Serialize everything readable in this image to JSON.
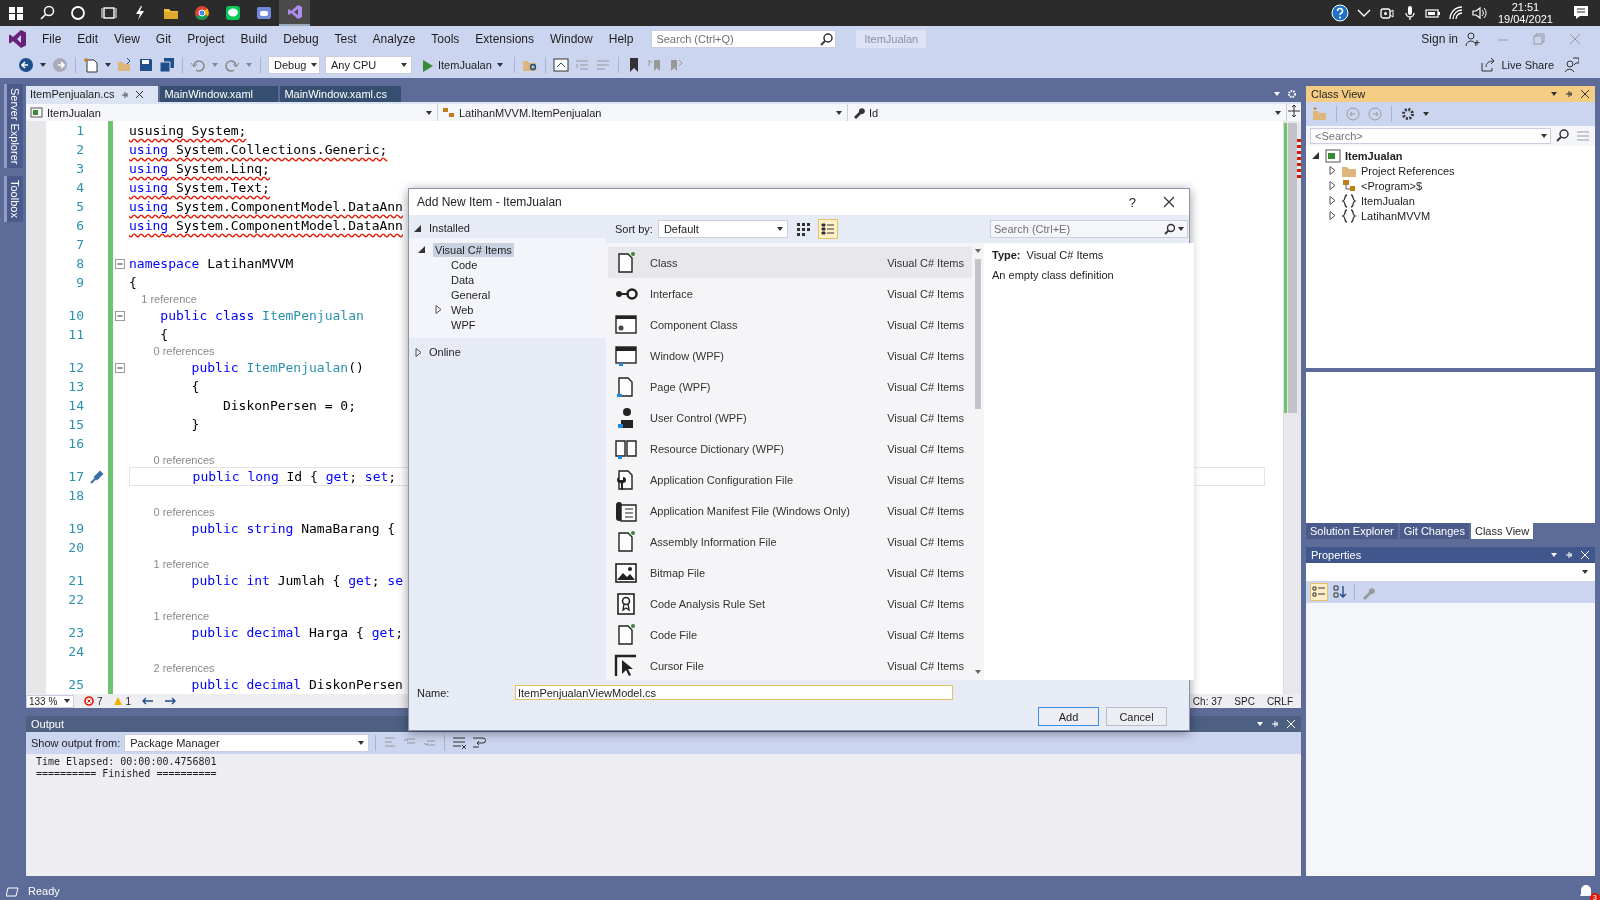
{
  "taskbar": {
    "apps": [
      {
        "kind": "bolt",
        "selected": false
      },
      {
        "kind": "folder",
        "selected": false
      },
      {
        "kind": "browser",
        "selected": false
      },
      {
        "kind": "chat",
        "selected": false
      },
      {
        "kind": "game",
        "selected": false
      },
      {
        "kind": "ide",
        "selected": true
      }
    ],
    "time": "21:51",
    "date": "19/04/2021"
  },
  "menu": [
    "File",
    "Edit",
    "View",
    "Git",
    "Project",
    "Build",
    "Debug",
    "Test",
    "Analyze",
    "Tools",
    "Extensions",
    "Window",
    "Help"
  ],
  "search": {
    "placeholder": "Search (Ctrl+Q)"
  },
  "solution_name": "ItemJualan",
  "sign_in": "Sign in",
  "toolbar": {
    "configuration": "Debug",
    "platform": "Any CPU",
    "start_target": "ItemJualan",
    "live_share": "Live Share"
  },
  "side_tabs": [
    "Server Explorer",
    "Toolbox"
  ],
  "editor": {
    "tabs": [
      {
        "label": "ItemPenjualan.cs",
        "selected": true
      },
      {
        "label": "MainWindow.xaml",
        "selected": false
      },
      {
        "label": "MainWindow.xaml.cs",
        "selected": false
      }
    ],
    "nav": [
      "ItemJualan",
      "LatihanMVVM.ItemPenjualan",
      "Id"
    ],
    "lines": [
      {
        "number": "1",
        "error": true,
        "tokens": [
          {
            "text": "ususing System;",
            "kind": "plain"
          }
        ]
      },
      {
        "number": "2",
        "error": true,
        "tokens": [
          {
            "text": "using",
            "kind": "kw"
          },
          {
            "text": " System.Collections.Generic;",
            "kind": "plain"
          }
        ]
      },
      {
        "number": "3",
        "error": true,
        "tokens": [
          {
            "text": "using",
            "kind": "kw"
          },
          {
            "text": " System.Linq;",
            "kind": "plain"
          }
        ]
      },
      {
        "number": "4",
        "error": true,
        "tokens": [
          {
            "text": "using",
            "kind": "kw"
          },
          {
            "text": " System.Text;",
            "kind": "plain"
          }
        ]
      },
      {
        "number": "5",
        "error": true,
        "tokens": [
          {
            "text": "using",
            "kind": "kw"
          },
          {
            "text": " System.ComponentModel.DataAnn",
            "kind": "plain"
          }
        ]
      },
      {
        "number": "6",
        "error": true,
        "tokens": [
          {
            "text": "using",
            "kind": "kw"
          },
          {
            "text": " System.ComponentModel.DataAnn",
            "kind": "plain"
          }
        ]
      },
      {
        "number": "7"
      },
      {
        "number": "8",
        "collapsible": true,
        "tokens": [
          {
            "text": "namespace",
            "kind": "kw"
          },
          {
            "text": " LatihanMVVM",
            "kind": "plain"
          }
        ]
      },
      {
        "number": "9",
        "tokens": [
          {
            "text": "{",
            "kind": "plain"
          }
        ]
      },
      {
        "number": "10",
        "ref": "1 reference",
        "collapsible": true,
        "tokens": [
          {
            "text": "    public class",
            "kind": "kw"
          },
          {
            "text": " ItemPenjualan",
            "kind": "type"
          }
        ]
      },
      {
        "number": "11",
        "tokens": [
          {
            "text": "    {",
            "kind": "plain"
          }
        ]
      },
      {
        "number": "12",
        "ref": "0 references",
        "collapsible": true,
        "tokens": [
          {
            "text": "        public",
            "kind": "kw"
          },
          {
            "text": " ItemPenjualan",
            "kind": "type"
          },
          {
            "text": "()",
            "kind": "plain"
          }
        ]
      },
      {
        "number": "13",
        "tokens": [
          {
            "text": "        {",
            "kind": "plain"
          }
        ]
      },
      {
        "number": "14",
        "tokens": [
          {
            "text": "            DiskonPersen = 0;",
            "kind": "plain"
          }
        ]
      },
      {
        "number": "15",
        "tokens": [
          {
            "text": "        }",
            "kind": "plain"
          }
        ]
      },
      {
        "number": "16"
      },
      {
        "number": "17",
        "ref": "0 references",
        "current": true,
        "quick_action": true,
        "tokens": [
          {
            "text": "        public long",
            "kind": "kw"
          },
          {
            "text": " Id { ",
            "kind": "plain"
          },
          {
            "text": "get",
            "kind": "kw"
          },
          {
            "text": "; ",
            "kind": "plain"
          },
          {
            "text": "set",
            "kind": "kw"
          },
          {
            "text": ";",
            "kind": "plain"
          }
        ]
      },
      {
        "number": "18"
      },
      {
        "number": "19",
        "ref": "0 references",
        "tokens": [
          {
            "text": "        public string",
            "kind": "kw"
          },
          {
            "text": " NamaBarang {",
            "kind": "plain"
          }
        ]
      },
      {
        "number": "20"
      },
      {
        "number": "21",
        "ref": "1 reference",
        "tokens": [
          {
            "text": "        public int",
            "kind": "kw"
          },
          {
            "text": " Jumlah { ",
            "kind": "plain"
          },
          {
            "text": "get",
            "kind": "kw"
          },
          {
            "text": "; ",
            "kind": "plain"
          },
          {
            "text": "se",
            "kind": "kw"
          }
        ]
      },
      {
        "number": "22"
      },
      {
        "number": "23",
        "ref": "1 reference",
        "tokens": [
          {
            "text": "        public decimal",
            "kind": "kw"
          },
          {
            "text": " Harga { ",
            "kind": "plain"
          },
          {
            "text": "get",
            "kind": "kw"
          },
          {
            "text": ";",
            "kind": "plain"
          }
        ]
      },
      {
        "number": "24"
      },
      {
        "number": "25",
        "ref": "2 references",
        "tokens": [
          {
            "text": "        public decimal",
            "kind": "kw"
          },
          {
            "text": " DiskonPersen",
            "kind": "plain"
          }
        ]
      }
    ],
    "zoom": "133 %",
    "errors": "7",
    "warnings": "1",
    "position": "Ch: 37",
    "indent": "SPC",
    "line_ending": "CRLF"
  },
  "output": {
    "title": "Output",
    "source_label": "Show output from:",
    "source": "Package Manager",
    "lines": [
      "Time Elapsed: 00:00:00.4756801",
      "========== Finished =========="
    ]
  },
  "class_view": {
    "title": "Class View",
    "search_placeholder": "<Search>",
    "tree": [
      {
        "label": "ItemJualan",
        "kind": "project",
        "expanded": true,
        "children": [
          {
            "label": "Project References",
            "kind": "references",
            "expanded": false
          },
          {
            "label": "<Program>$",
            "kind": "class",
            "expanded": false
          },
          {
            "label": "ItemJualan",
            "kind": "namespace",
            "expanded": false
          },
          {
            "label": "LatihanMVVM",
            "kind": "namespace",
            "expanded": false
          }
        ]
      }
    ]
  },
  "panel_tabs": [
    {
      "label": "Solution Explorer",
      "selected": false
    },
    {
      "label": "Git Changes",
      "selected": false
    },
    {
      "label": "Class View",
      "selected": true
    }
  ],
  "properties": {
    "title": "Properties"
  },
  "status_bar": {
    "text": "Ready",
    "notifications": "3"
  },
  "dialog": {
    "title": "Add New Item - ItemJualan",
    "help": "?",
    "tree": [
      {
        "label": "Installed",
        "expanded": true,
        "children": [
          {
            "label": "Visual C# Items",
            "expanded": true,
            "selected": true,
            "children": [
              {
                "label": "Code",
                "selected": false
              },
              {
                "label": "Data",
                "selected": false
              },
              {
                "label": "General",
                "selected": false
              },
              {
                "label": "Web",
                "expanded": false,
                "selected": false
              },
              {
                "label": "WPF",
                "selected": false
              }
            ]
          }
        ]
      },
      {
        "label": "Online",
        "expanded": false
      }
    ],
    "sort_label": "Sort by:",
    "sort": "Default",
    "views": [
      {
        "kind": "grid",
        "selected": false
      },
      {
        "kind": "list",
        "selected": true
      }
    ],
    "search_placeholder": "Search (Ctrl+E)",
    "items": [
      {
        "name": "Class",
        "category": "Visual C# Items",
        "kind": "class",
        "selected": true
      },
      {
        "name": "Interface",
        "category": "Visual C# Items",
        "kind": "interface",
        "selected": false
      },
      {
        "name": "Component Class",
        "category": "Visual C# Items",
        "kind": "component",
        "selected": false
      },
      {
        "name": "Window (WPF)",
        "category": "Visual C# Items",
        "kind": "window",
        "selected": false
      },
      {
        "name": "Page (WPF)",
        "category": "Visual C# Items",
        "kind": "page",
        "selected": false
      },
      {
        "name": "User Control (WPF)",
        "category": "Visual C# Items",
        "kind": "user-control",
        "selected": false
      },
      {
        "name": "Resource Dictionary (WPF)",
        "category": "Visual C# Items",
        "kind": "dictionary",
        "selected": false
      },
      {
        "name": "Application Configuration File",
        "category": "Visual C# Items",
        "kind": "config",
        "selected": false
      },
      {
        "name": "Application Manifest File (Windows Only)",
        "category": "Visual C# Items",
        "kind": "manifest",
        "selected": false
      },
      {
        "name": "Assembly Information File",
        "category": "Visual C# Items",
        "kind": "assembly-info",
        "selected": false
      },
      {
        "name": "Bitmap File",
        "category": "Visual C# Items",
        "kind": "bitmap",
        "selected": false
      },
      {
        "name": "Code Analysis Rule Set",
        "category": "Visual C# Items",
        "kind": "rule-set",
        "selected": false
      },
      {
        "name": "Code File",
        "category": "Visual C# Items",
        "kind": "code",
        "selected": false
      },
      {
        "name": "Cursor File",
        "category": "Visual C# Items",
        "kind": "cursor",
        "selected": false
      }
    ],
    "details": {
      "type_label": "Type:",
      "type": "Visual C# Items",
      "description": "An empty class definition"
    },
    "name_label": "Name:",
    "name_value": "ItemPenjualanViewModel.cs",
    "buttons": [
      {
        "label": "Add",
        "default": true
      },
      {
        "label": "Cancel",
        "default": false
      }
    ]
  }
}
